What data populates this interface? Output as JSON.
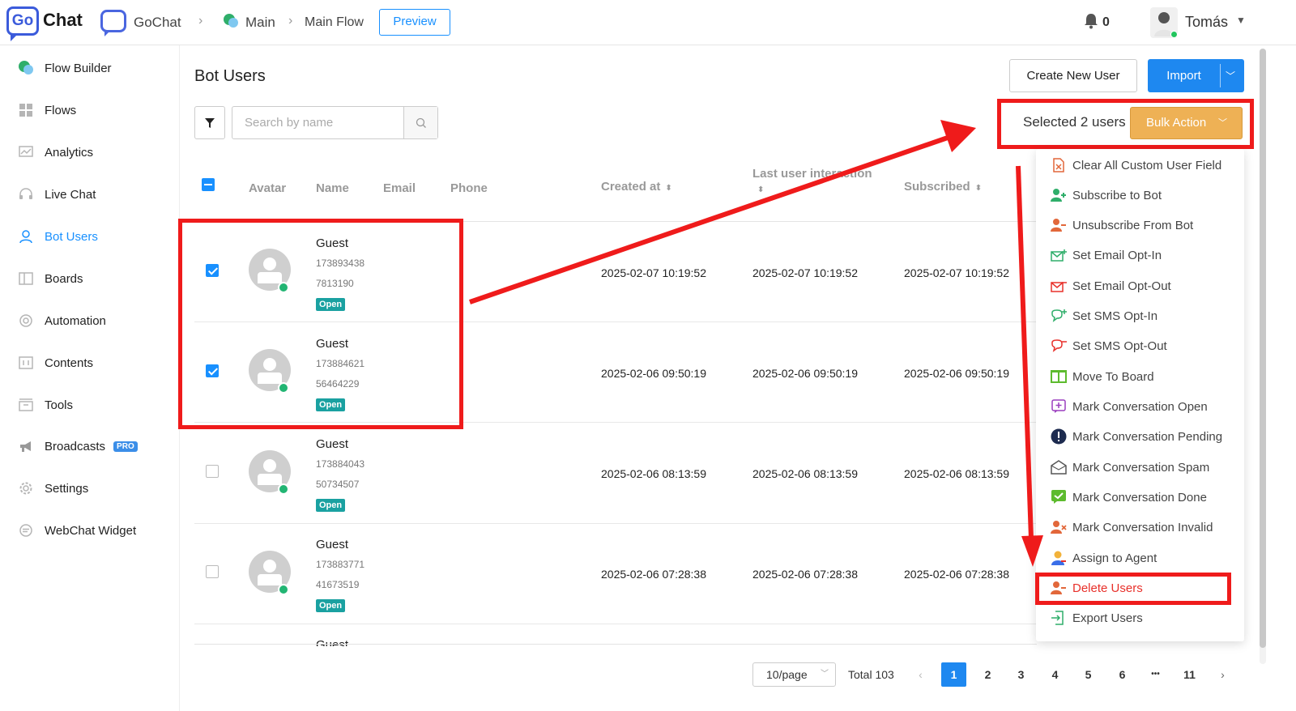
{
  "header": {
    "logo_go": "Go",
    "logo_chat": "Chat",
    "workspace": "GoChat",
    "breadcrumb_main": "Main",
    "breadcrumb_flow": "Main Flow",
    "preview_label": "Preview",
    "notification_count": "0",
    "user_name": "Tomás"
  },
  "sidebar": {
    "items": [
      {
        "label": "Flow Builder",
        "icon": "flow-builder-icon"
      },
      {
        "label": "Flows",
        "icon": "grid-icon"
      },
      {
        "label": "Analytics",
        "icon": "chart-icon"
      },
      {
        "label": "Live Chat",
        "icon": "headset-icon"
      },
      {
        "label": "Bot Users",
        "icon": "user-icon",
        "active": true
      },
      {
        "label": "Boards",
        "icon": "board-icon"
      },
      {
        "label": "Automation",
        "icon": "automation-icon"
      },
      {
        "label": "Contents",
        "icon": "contents-icon"
      },
      {
        "label": "Tools",
        "icon": "tools-icon"
      },
      {
        "label": "Broadcasts",
        "icon": "megaphone-icon",
        "badge": "PRO"
      },
      {
        "label": "Settings",
        "icon": "gear-icon"
      },
      {
        "label": "WebChat Widget",
        "icon": "chat-widget-icon"
      }
    ]
  },
  "main": {
    "title": "Bot Users",
    "create_label": "Create New User",
    "import_label": "Import",
    "search_placeholder": "Search by name",
    "selected_text": "Selected 2 users",
    "bulk_action_label": "Bulk Action"
  },
  "table": {
    "columns": {
      "avatar": "Avatar",
      "name": "Name",
      "email": "Email",
      "phone": "Phone",
      "created_at": "Created at",
      "last_interaction": "Last user interaction",
      "subscribed": "Subscribed"
    },
    "rows": [
      {
        "name": "Guest",
        "id1": "173893438",
        "id2": "7813190",
        "status": "Open",
        "created": "2025-02-07 10:19:52",
        "last": "2025-02-07 10:19:52",
        "subscribed": "2025-02-07 10:19:52",
        "checked": true
      },
      {
        "name": "Guest",
        "id1": "173884621",
        "id2": "56464229",
        "status": "Open",
        "created": "2025-02-06 09:50:19",
        "last": "2025-02-06 09:50:19",
        "subscribed": "2025-02-06 09:50:19",
        "checked": true
      },
      {
        "name": "Guest",
        "id1": "173884043",
        "id2": "50734507",
        "status": "Open",
        "created": "2025-02-06 08:13:59",
        "last": "2025-02-06 08:13:59",
        "subscribed": "2025-02-06 08:13:59",
        "checked": false
      },
      {
        "name": "Guest",
        "id1": "173883771",
        "id2": "41673519",
        "status": "Open",
        "created": "2025-02-06 07:28:38",
        "last": "2025-02-06 07:28:38",
        "subscribed": "2025-02-06 07:28:38",
        "checked": false
      },
      {
        "name": "Guest"
      }
    ]
  },
  "bulk_menu": {
    "items": [
      {
        "label": "Clear All Custom User Field",
        "icon": "clear-field-icon",
        "color": "#e2673a"
      },
      {
        "label": "Subscribe to Bot",
        "icon": "user-plus-icon",
        "color": "#2fae6a"
      },
      {
        "label": "Unsubscribe From Bot",
        "icon": "user-minus-icon",
        "color": "#e2673a"
      },
      {
        "label": "Set Email Opt-In",
        "icon": "email-in-icon",
        "color": "#2fae6a"
      },
      {
        "label": "Set Email Opt-Out",
        "icon": "email-out-icon",
        "color": "#e8302a"
      },
      {
        "label": "Set SMS Opt-In",
        "icon": "sms-in-icon",
        "color": "#2fae6a"
      },
      {
        "label": "Set SMS Opt-Out",
        "icon": "sms-out-icon",
        "color": "#e8302a"
      },
      {
        "label": "Move To Board",
        "icon": "board-move-icon",
        "color": "#5dbb2e"
      },
      {
        "label": "Mark Conversation Open",
        "icon": "conversation-open-icon",
        "color": "#9b3fbf"
      },
      {
        "label": "Mark Conversation Pending",
        "icon": "exclamation-icon",
        "color": "#1d2b4f"
      },
      {
        "label": "Mark Conversation Spam",
        "icon": "spam-icon",
        "color": "#555555"
      },
      {
        "label": "Mark Conversation Done",
        "icon": "check-done-icon",
        "color": "#5dbb2e"
      },
      {
        "label": "Mark Conversation Invalid",
        "icon": "user-invalid-icon",
        "color": "#e2673a"
      },
      {
        "label": "Assign to Agent",
        "icon": "agent-icon",
        "color": "#3a6ee8"
      },
      {
        "label": "Delete Users",
        "icon": "user-delete-icon",
        "color": "#e2673a",
        "danger": true
      },
      {
        "label": "Export Users",
        "icon": "export-icon",
        "color": "#2fae6a"
      }
    ]
  },
  "pagination": {
    "page_size": "10/page",
    "total": "Total 103",
    "pages": [
      "1",
      "2",
      "3",
      "4",
      "5",
      "6",
      "•••",
      "11"
    ],
    "current": "1"
  },
  "colors": {
    "accent": "#1e88f0",
    "bulk_action": "#eeb155",
    "annotation_red": "#ef1b1b",
    "open_tag": "#1aa1a1"
  }
}
